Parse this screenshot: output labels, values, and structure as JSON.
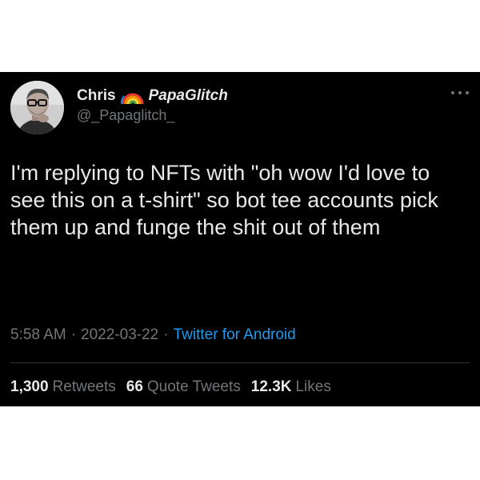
{
  "user": {
    "display_name": "Chris",
    "display_name_suffix": "PapaGlitch",
    "badge_icon": "rainbow-icon",
    "handle": "@_Papaglitch_",
    "avatar_icon": "avatar-photo-icon"
  },
  "tweet": {
    "text": "I'm replying to NFTs with \"oh wow I'd love to see this on a t-shirt\" so bot tee accounts pick them up and funge the shit out of them"
  },
  "meta": {
    "time": "5:58 AM",
    "separator": "·",
    "date": "2022-03-22",
    "source": "Twitter for Android"
  },
  "stats": {
    "retweets_count": "1,300",
    "retweets_label": "Retweets",
    "quotes_count": "66",
    "quotes_label": "Quote Tweets",
    "likes_count": "12.3K",
    "likes_label": "Likes"
  },
  "colors": {
    "background": "#000000",
    "text": "#e7e9ea",
    "secondary_text": "#71767b",
    "link": "#1d9bf0",
    "page_background": "#ffffff"
  }
}
